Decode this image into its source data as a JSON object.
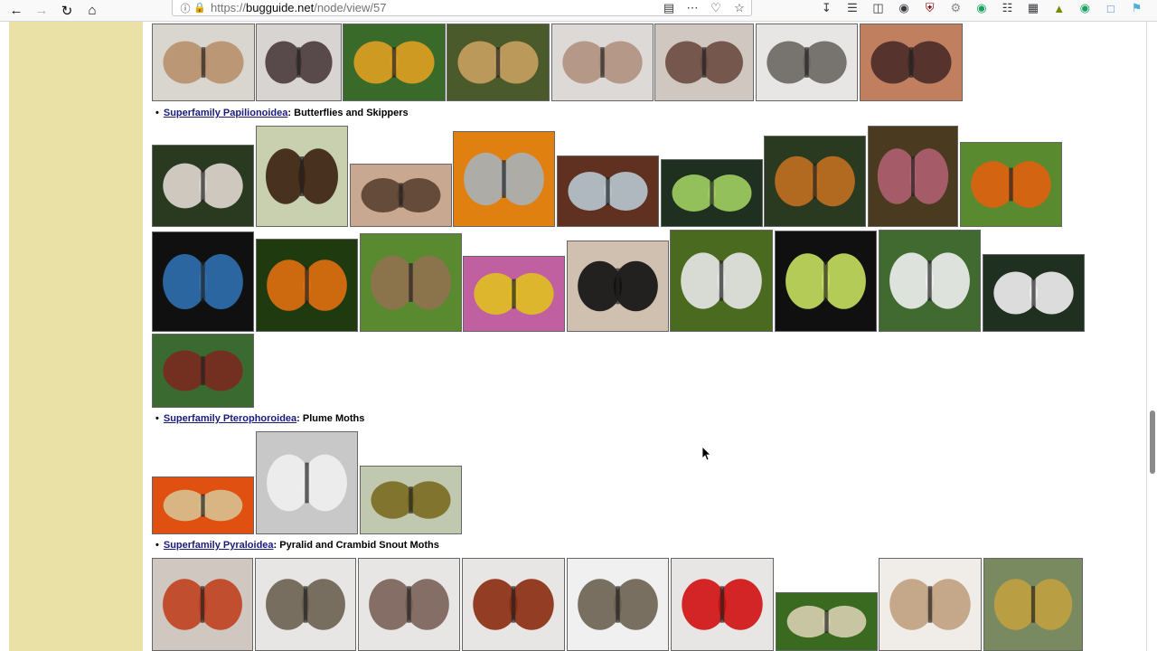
{
  "browser": {
    "url_prefix": "https://",
    "url_host": "bugguide.net",
    "url_path": "/node/view/57",
    "icons": {
      "back": "arrow-left-icon",
      "forward": "arrow-right-icon",
      "reload": "reload-icon",
      "home": "home-icon",
      "reader": "reader-view-icon",
      "more": "ellipsis-icon",
      "pocket": "pocket-icon",
      "bookmark": "star-icon"
    }
  },
  "sections": [
    {
      "link": "Superfamily Papilionoidea",
      "rest": ": Butterflies and Skippers"
    },
    {
      "link": "Superfamily Pterophoroidea",
      "rest": ": Plume Moths"
    },
    {
      "link": "Superfamily Pyraloidea",
      "rest": ": Pyralid and Crambid Snout Moths"
    }
  ],
  "colors": {
    "sidebar": "#e9e1a6",
    "link": "#1a1a7a"
  }
}
